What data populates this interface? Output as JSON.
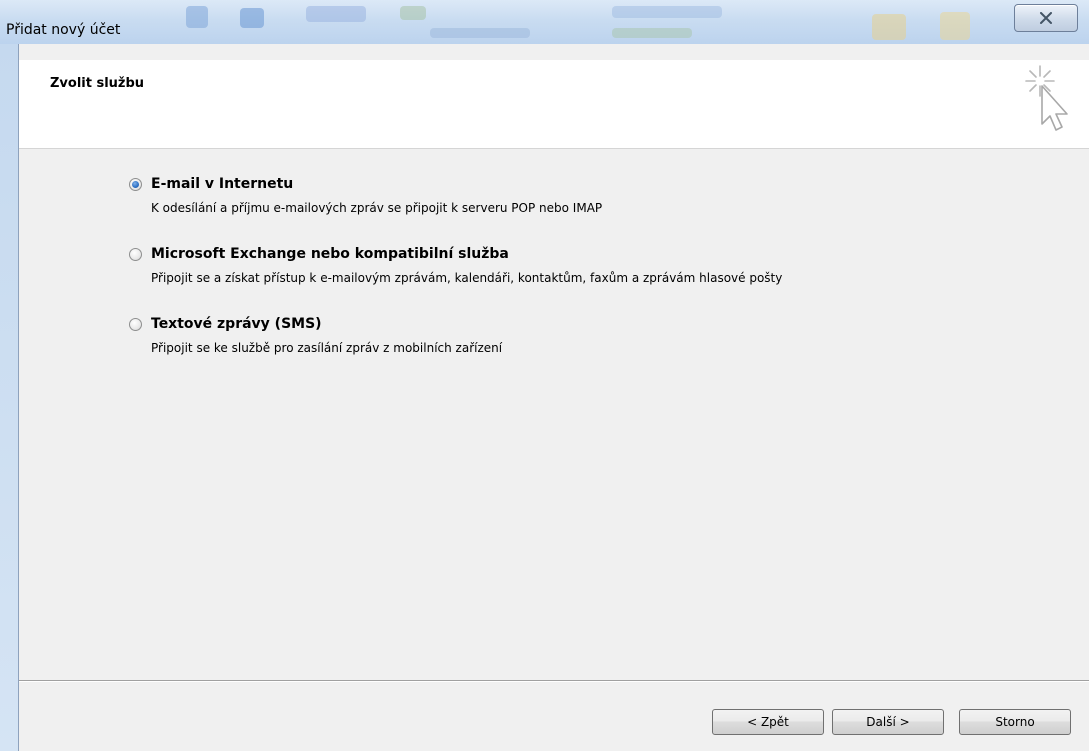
{
  "window": {
    "title": "Přidat nový účet"
  },
  "header": {
    "title": "Zvolit službu"
  },
  "options": [
    {
      "label": "E-mail v Internetu",
      "description": "K odesílání a příjmu e-mailových zpráv se připojit k serveru POP nebo IMAP",
      "selected": true
    },
    {
      "label": "Microsoft Exchange nebo kompatibilní služba",
      "description": "Připojit se a získat přístup k e-mailovým zprávám, kalendáři, kontaktům, faxům a zprávám hlasové pošty",
      "selected": false
    },
    {
      "label": "Textové zprávy (SMS)",
      "description": "Připojit se ke službě pro zasílání zpráv z mobilních zařízení",
      "selected": false
    }
  ],
  "buttons": {
    "back": "< Zpět",
    "next": "Další >",
    "cancel": "Storno"
  },
  "icons": {
    "close": "close-icon",
    "wizard": "wizard-cursor-icon"
  },
  "colors": {
    "titlebar": "#c9dcf1",
    "radio_selected": "#2c6fc4",
    "dialog_background": "#f0f0f0"
  }
}
